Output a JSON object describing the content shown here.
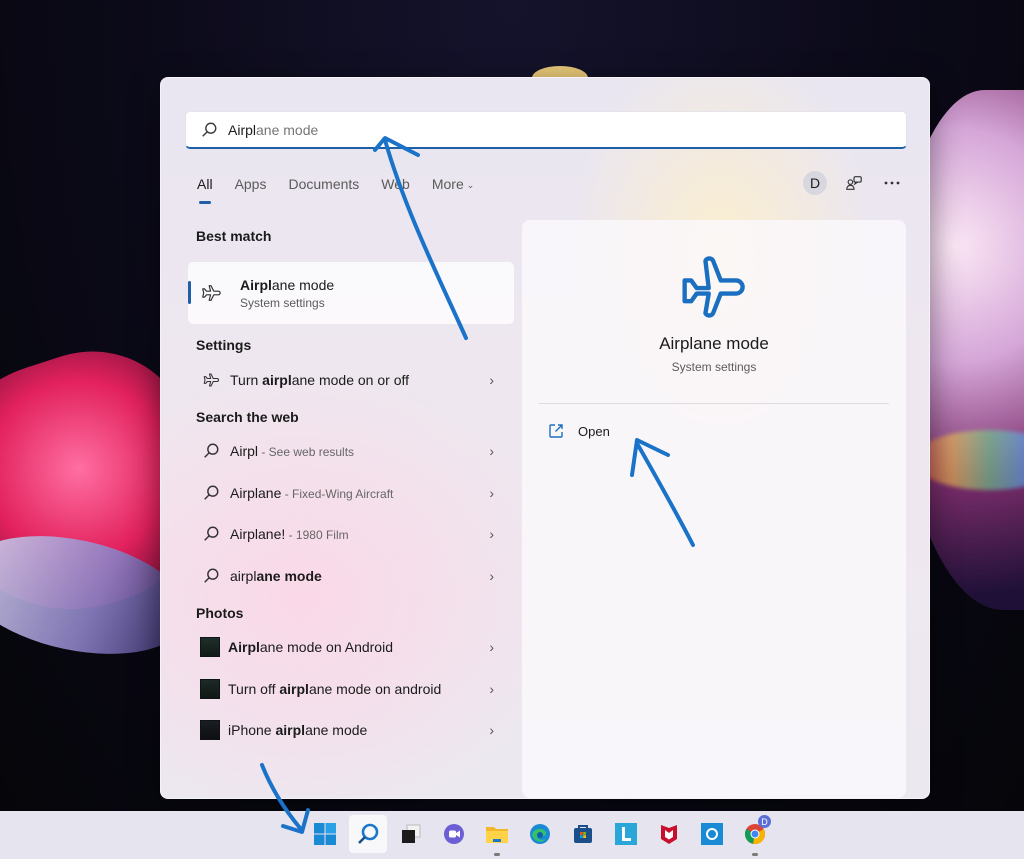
{
  "search": {
    "query_typed": "Airpl",
    "query_completion": "ane mode"
  },
  "filter_tabs": [
    {
      "label": "All",
      "active": true
    },
    {
      "label": "Apps",
      "active": false
    },
    {
      "label": "Documents",
      "active": false
    },
    {
      "label": "Web",
      "active": false
    },
    {
      "label": "More",
      "active": false
    }
  ],
  "account": {
    "initial": "D"
  },
  "sections": {
    "best_match": {
      "title": "Best match",
      "item": {
        "title_bold": "Airpl",
        "title_rest": "ane mode",
        "subtitle": "System settings"
      }
    },
    "settings": {
      "title": "Settings",
      "items": [
        {
          "pre": "Turn ",
          "bold": "airpl",
          "post": "ane mode on or off"
        }
      ]
    },
    "web": {
      "title": "Search the web",
      "items": [
        {
          "bold": "Airpl",
          "sub": " - See web results"
        },
        {
          "bold": "Airplane",
          "sub": " - Fixed-Wing Aircraft"
        },
        {
          "bold": "Airplane!",
          "sub": " - 1980 Film"
        },
        {
          "pre": "airpl",
          "bold": "ane mode",
          "sub": ""
        }
      ]
    },
    "photos": {
      "title": "Photos",
      "items": [
        {
          "pre": "",
          "bold": "Airpl",
          "post": "ane mode on Android"
        },
        {
          "pre": "Turn off ",
          "bold": "airpl",
          "post": "ane mode on android"
        },
        {
          "pre": "iPhone ",
          "bold": "airpl",
          "post": "ane mode"
        }
      ]
    }
  },
  "preview": {
    "title": "Airplane mode",
    "subtitle": "System settings",
    "actions": [
      {
        "label": "Open",
        "icon": "open-external-icon"
      }
    ]
  },
  "taskbar": {
    "items": [
      {
        "name": "start",
        "icon": "windows-logo-icon"
      },
      {
        "name": "search",
        "icon": "search-icon",
        "active": true
      },
      {
        "name": "task-view",
        "icon": "task-view-icon"
      },
      {
        "name": "teams-chat",
        "icon": "chat-icon"
      },
      {
        "name": "file-explorer",
        "icon": "folder-icon",
        "running": true
      },
      {
        "name": "edge",
        "icon": "edge-icon"
      },
      {
        "name": "store",
        "icon": "store-icon"
      },
      {
        "name": "l-app",
        "icon": "l-app-icon"
      },
      {
        "name": "mcafee",
        "icon": "mcafee-icon"
      },
      {
        "name": "cortana",
        "icon": "cortana-icon"
      },
      {
        "name": "chrome",
        "icon": "chrome-icon",
        "running": true,
        "badge": "D"
      }
    ]
  },
  "colors": {
    "accent": "#1f5fa8",
    "preview_icon": "#1b6fc0",
    "annotation": "#1a73c8"
  }
}
